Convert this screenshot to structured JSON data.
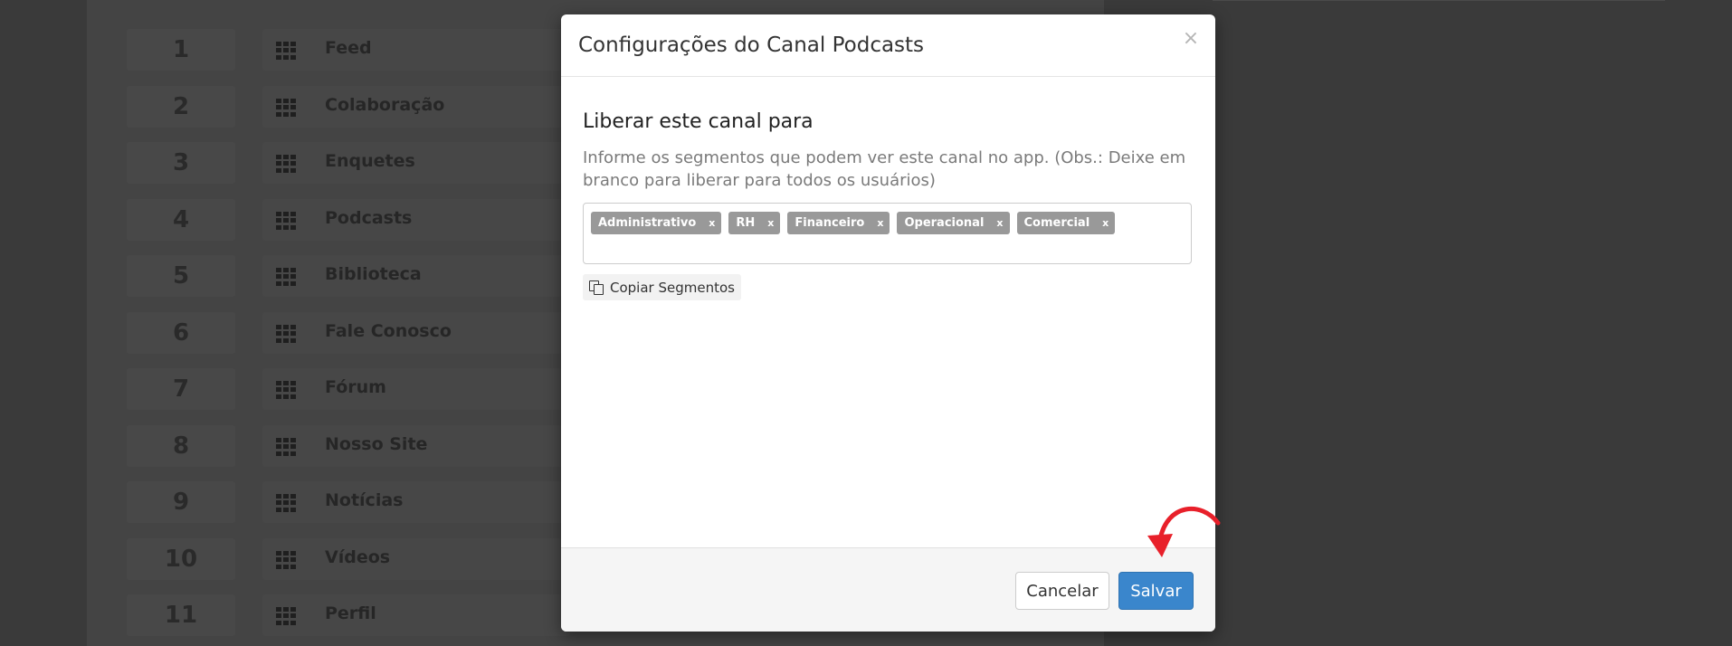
{
  "background": {
    "rows": [
      {
        "num": "1",
        "label": "Feed"
      },
      {
        "num": "2",
        "label": "Colaboração"
      },
      {
        "num": "3",
        "label": "Enquetes"
      },
      {
        "num": "4",
        "label": "Podcasts"
      },
      {
        "num": "5",
        "label": "Biblioteca"
      },
      {
        "num": "6",
        "label": "Fale Conosco"
      },
      {
        "num": "7",
        "label": "Fórum"
      },
      {
        "num": "8",
        "label": "Nosso Site"
      },
      {
        "num": "9",
        "label": "Notícias"
      },
      {
        "num": "10",
        "label": "Vídeos"
      },
      {
        "num": "11",
        "label": "Perfil"
      }
    ]
  },
  "modal": {
    "title": "Configurações do Canal Podcasts",
    "close_symbol": "×",
    "section_title": "Liberar este canal para",
    "help_text": "Informe os segmentos que podem ver este canal no app. (Obs.: Deixe em branco para liberar para todos os usuários)",
    "tags": [
      {
        "label": "Administrativo",
        "remove": "x"
      },
      {
        "label": "RH",
        "remove": "x"
      },
      {
        "label": "Financeiro",
        "remove": "x"
      },
      {
        "label": "Operacional",
        "remove": "x"
      },
      {
        "label": "Comercial",
        "remove": "x"
      }
    ],
    "copy_button": "Copiar Segmentos",
    "cancel_button": "Cancelar",
    "save_button": "Salvar"
  },
  "colors": {
    "overlay": "#3a3a3a",
    "tag": "#999999",
    "primary": "#3a86cc",
    "annotation_arrow": "#e8202a"
  }
}
